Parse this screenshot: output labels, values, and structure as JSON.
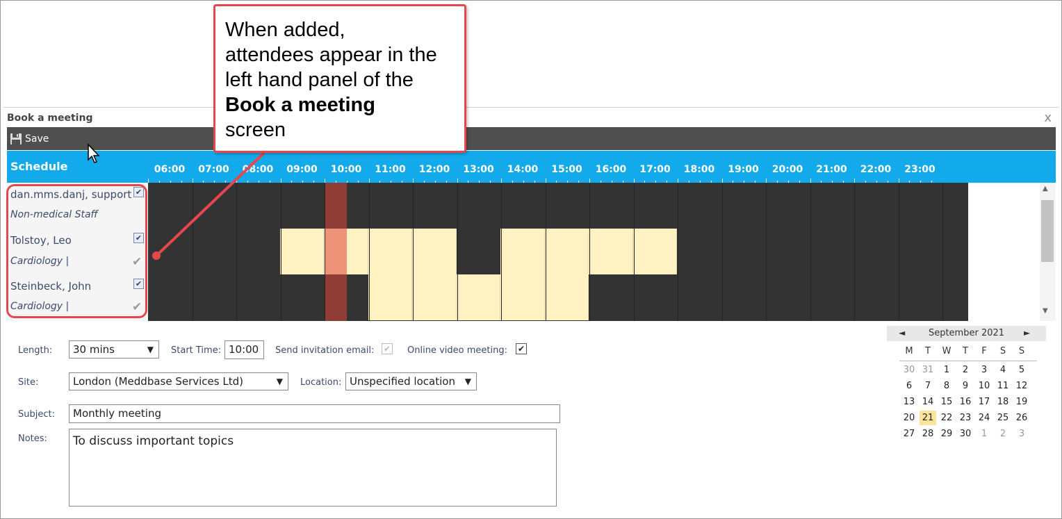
{
  "callout": {
    "line1": "When added,",
    "line2": "attendees appear in the",
    "line3": "left hand panel of the",
    "line4_bold": "Book a meeting",
    "line5": "screen"
  },
  "dialog": {
    "title": "Book a meeting",
    "close": "x",
    "save_label": "Save"
  },
  "schedule": {
    "label": "Schedule",
    "hours": [
      "06:00",
      "07:00",
      "08:00",
      "09:00",
      "10:00",
      "11:00",
      "12:00",
      "13:00",
      "14:00",
      "15:00",
      "16:00",
      "17:00",
      "18:00",
      "19:00",
      "20:00",
      "21:00",
      "22:00",
      "23:00"
    ],
    "selected_slot_start": "10:00",
    "attendees": [
      {
        "name": "dan.mms.danj, support",
        "dept": "Non-medical Staff",
        "checked": true,
        "busy_hours": []
      },
      {
        "name": "Tolstoy, Leo",
        "dept": "Cardiology  |",
        "checked": true,
        "busy_hours": [
          [
            "09:00",
            "13:00"
          ],
          [
            "14:00",
            "18:00"
          ]
        ]
      },
      {
        "name": "Steinbeck, John",
        "dept": "Cardiology  |",
        "checked": true,
        "busy_hours": [
          [
            "11:00",
            "16:00"
          ]
        ]
      }
    ]
  },
  "form": {
    "length_label": "Length:",
    "length_value": "30 mins",
    "start_time_label": "Start Time:",
    "start_time_value": "10:00",
    "send_invite_label": "Send invitation email:",
    "send_invite_checked": true,
    "online_video_label": "Online video meeting:",
    "online_video_checked": true,
    "site_label": "Site:",
    "site_value": "London (Meddbase Services Ltd)",
    "location_label": "Location:",
    "location_value": "Unspecified location",
    "subject_label": "Subject:",
    "subject_value": "Monthly meeting",
    "notes_label": "Notes:",
    "notes_value": "To discuss important topics"
  },
  "calendar": {
    "prev": "◄",
    "next": "►",
    "month": "September 2021",
    "dow": [
      "M",
      "T",
      "W",
      "T",
      "F",
      "S",
      "S"
    ],
    "weeks": [
      [
        "30",
        "31",
        "1",
        "2",
        "3",
        "4",
        "5"
      ],
      [
        "6",
        "7",
        "8",
        "9",
        "10",
        "11",
        "12"
      ],
      [
        "13",
        "14",
        "15",
        "16",
        "17",
        "18",
        "19"
      ],
      [
        "20",
        "21",
        "22",
        "23",
        "24",
        "25",
        "26"
      ],
      [
        "27",
        "28",
        "29",
        "30",
        "1",
        "2",
        "3"
      ]
    ],
    "today": "21"
  },
  "colors": {
    "schedule_bar": "#12aaea",
    "busy": "#fff2c2",
    "grid": "#333333",
    "now": "#dc463c",
    "callout_border": "#e5474d"
  }
}
